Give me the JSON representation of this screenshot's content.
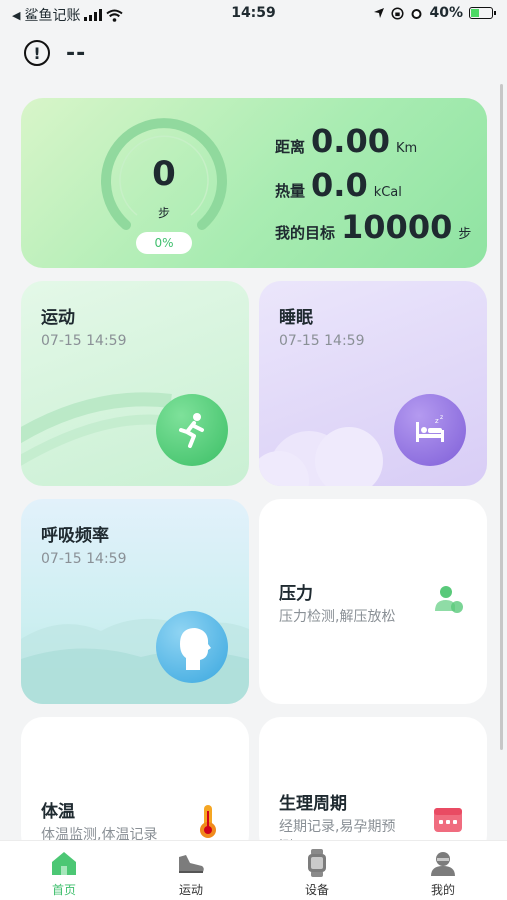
{
  "status": {
    "carrier": "鲨鱼记账",
    "time": "14:59",
    "battery": "40%",
    "battery_level": 0.4
  },
  "header": {
    "title": "--"
  },
  "steps": {
    "count": "0",
    "unit": "步",
    "percent": "0%",
    "distance_label": "距离",
    "distance_value": "0.00",
    "distance_unit": "Km",
    "calorie_label": "热量",
    "calorie_value": "0.0",
    "calorie_unit": "kCal",
    "goal_label": "我的目标",
    "goal_value": "10000",
    "goal_unit": "步"
  },
  "cards": {
    "sport": {
      "title": "运动",
      "time": "07-15 14:59"
    },
    "sleep": {
      "title": "睡眠",
      "time": "07-15 14:59"
    },
    "breath": {
      "title": "呼吸频率",
      "time": "07-15 14:59"
    },
    "stress": {
      "title": "压力",
      "desc": "压力检测,解压放松"
    },
    "temp": {
      "title": "体温",
      "desc": "体温监测,体温记录"
    },
    "period": {
      "title": "生理周期",
      "desc": "经期记录,易孕期预测"
    }
  },
  "tabs": [
    {
      "label": "首页",
      "icon": "home-icon"
    },
    {
      "label": "运动",
      "icon": "sneaker-icon"
    },
    {
      "label": "设备",
      "icon": "watch-icon"
    },
    {
      "label": "我的",
      "icon": "user-icon"
    }
  ],
  "colors": {
    "accent": "#3fbf6d",
    "sleep": "#8f6fe0",
    "breath": "#4db6e4"
  }
}
